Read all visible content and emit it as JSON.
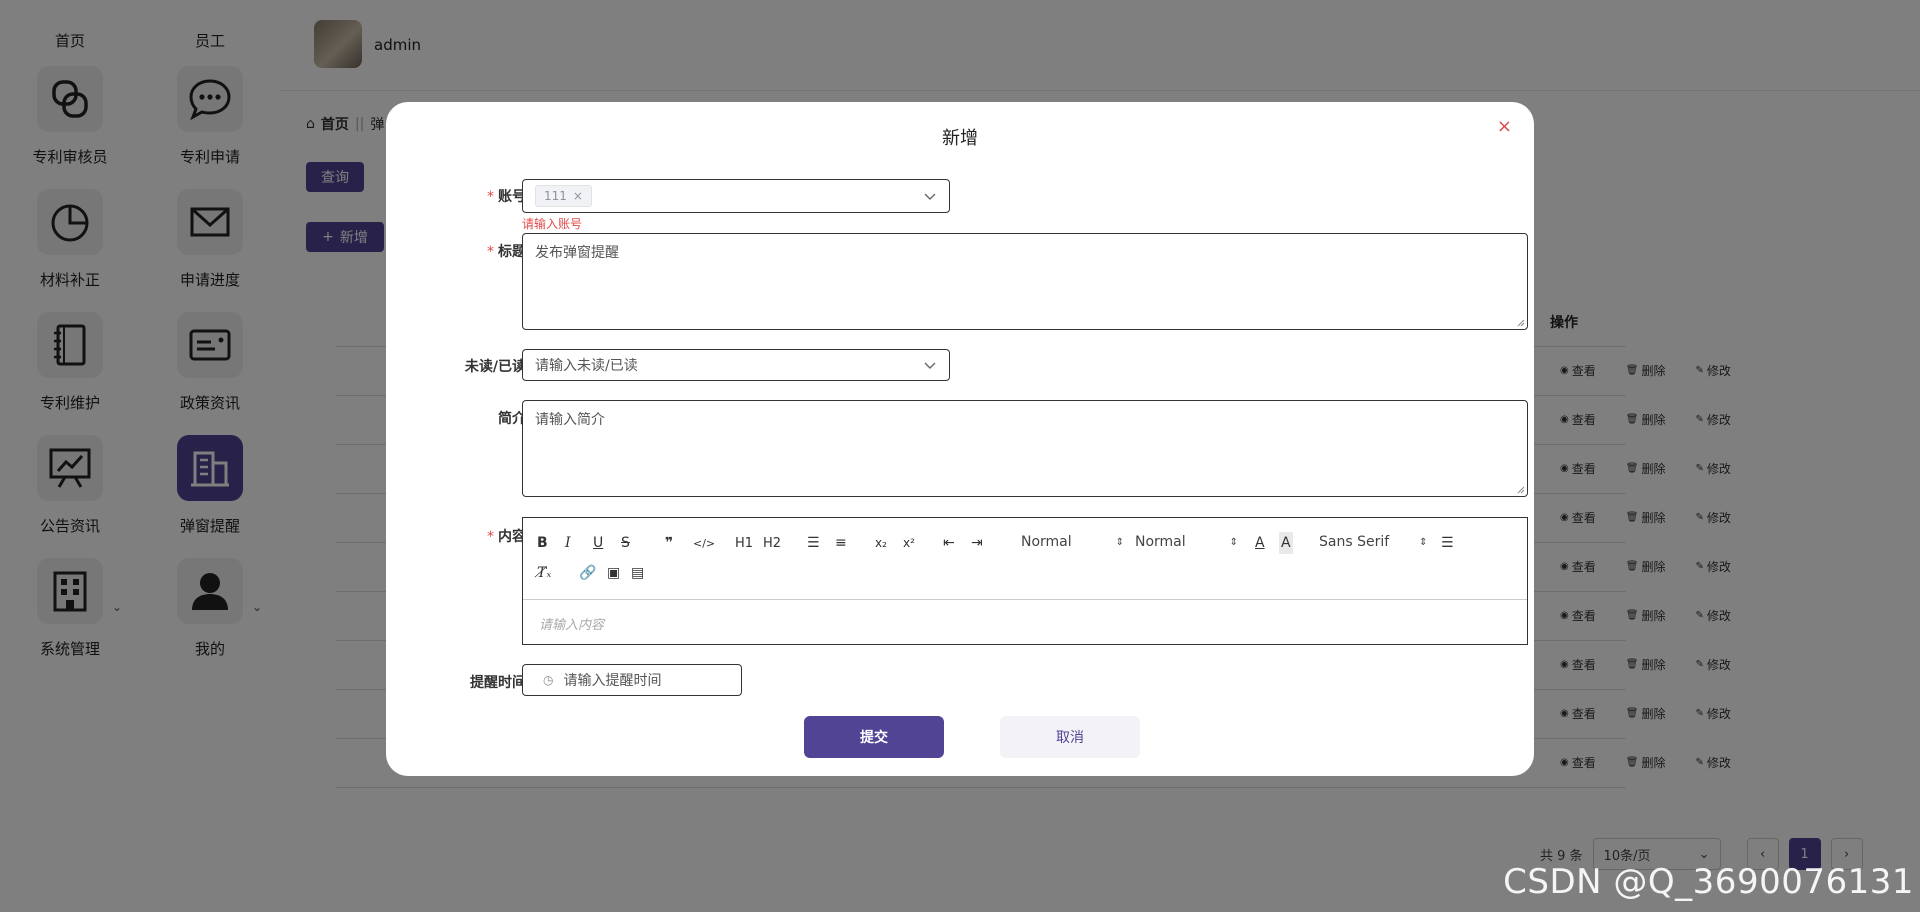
{
  "sidebar": {
    "top_labels": [
      "首页",
      "员工"
    ],
    "items": [
      {
        "label": "专利审核员",
        "icon": "chain-link-icon"
      },
      {
        "label": "专利申请",
        "icon": "chat-bubble-icon"
      },
      {
        "label": "材料补正",
        "icon": "pie-chart-icon"
      },
      {
        "label": "申请进度",
        "icon": "mail-icon"
      },
      {
        "label": "专利维护",
        "icon": "notebook-icon"
      },
      {
        "label": "政策资讯",
        "icon": "id-card-icon"
      },
      {
        "label": "公告资讯",
        "icon": "presentation-chart-icon"
      },
      {
        "label": "弹窗提醒",
        "icon": "building-icon"
      },
      {
        "label": "系统管理",
        "icon": "office-building-icon"
      },
      {
        "label": "我的",
        "icon": "user-icon"
      }
    ],
    "active_index": 7,
    "accent_color": "#514494"
  },
  "header": {
    "username": "admin"
  },
  "breadcrumb": {
    "home": "首页",
    "separator": "||",
    "current": "弹"
  },
  "toolbar": {
    "query_label": "查询",
    "add_label": "新增"
  },
  "table": {
    "ops_header": "操作",
    "row_count": 9,
    "actions": {
      "view": "查看",
      "delete": "删除",
      "edit": "修改"
    }
  },
  "pagination": {
    "total": "共 9 条",
    "page_size": "10条/页",
    "current_page": "1"
  },
  "dialog": {
    "title": "新增",
    "fields": {
      "account": {
        "label": "账号",
        "tag": "111",
        "error": "请输入账号"
      },
      "title": {
        "label": "标题",
        "value": "发布弹窗提醒"
      },
      "read_status": {
        "label": "未读/已读",
        "placeholder": "请输入未读/已读"
      },
      "summary": {
        "label": "简介",
        "placeholder": "请输入简介"
      },
      "content": {
        "label": "内容",
        "placeholder": "请输入内容",
        "toolbar": {
          "header_select": "Normal",
          "size_select": "Normal",
          "font_select": "Sans Serif",
          "buttons": [
            "B",
            "I",
            "U",
            "S",
            "❞",
            "</>",
            "H1",
            "H2"
          ]
        }
      },
      "remind_time": {
        "label": "提醒时间",
        "placeholder": "请输入提醒时间"
      }
    },
    "submit_label": "提交",
    "cancel_label": "取消"
  },
  "watermark": "CSDN @Q_3690076131"
}
